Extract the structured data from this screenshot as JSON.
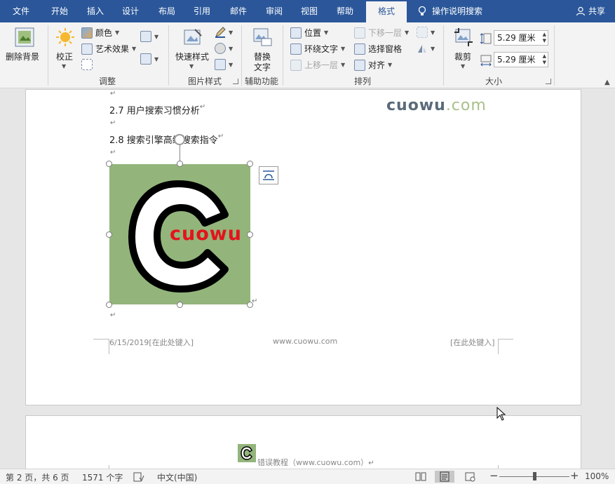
{
  "tabs": [
    {
      "label": "文件",
      "active": false
    },
    {
      "label": "开始",
      "active": false
    },
    {
      "label": "插入",
      "active": false
    },
    {
      "label": "设计",
      "active": false
    },
    {
      "label": "布局",
      "active": false
    },
    {
      "label": "引用",
      "active": false
    },
    {
      "label": "邮件",
      "active": false
    },
    {
      "label": "审阅",
      "active": false
    },
    {
      "label": "视图",
      "active": false
    },
    {
      "label": "帮助",
      "active": false
    },
    {
      "label": "格式",
      "active": true
    }
  ],
  "tell_me": {
    "label": "操作说明搜索",
    "icon": "lightbulb-icon"
  },
  "share": {
    "label": "共享",
    "icon": "person-icon"
  },
  "ribbon": {
    "adjust": {
      "remove_bg": "删除背景",
      "corrections": "校正",
      "color": "颜色",
      "artistic": "艺术效果",
      "group_label": "调整"
    },
    "picture_styles": {
      "quick_styles": "快速样式",
      "group_label": "图片样式"
    },
    "accessibility": {
      "alt_text_line1": "替换",
      "alt_text_line2": "文字",
      "group_label": "辅助功能"
    },
    "arrange": {
      "position": "位置",
      "wrap_text": "环绕文字",
      "bring_forward": "上移一层",
      "send_backward": "下移一层",
      "selection_pane": "选择窗格",
      "align": "对齐",
      "group_label": "排列"
    },
    "size": {
      "crop": "裁剪",
      "height": "5.29 厘米",
      "width": "5.29 厘米",
      "group_label": "大小"
    }
  },
  "document": {
    "heading_27": "2.7 用户搜索习惯分析",
    "heading_28": "2.8 搜索引擎高级搜索指令",
    "watermark_main": "cuowu",
    "watermark_suffix": ".com",
    "picture_text": "cuowu",
    "footer_date": "6/15/2019[在此处键入]",
    "footer_url": "www.cuowu.com",
    "footer_right": "[在此处键入]",
    "page2_header": "错误教程（www.cuowu.com）",
    "paragraph_mark": "↵"
  },
  "statusbar": {
    "page": "第 2 页，共 6 页",
    "words": "1571 个字",
    "language": "中文(中国)",
    "zoom_minus": "−",
    "zoom_plus": "+",
    "zoom_level": "100%",
    "zoom_value": 100
  },
  "colors": {
    "ribbon_blue": "#2b579a",
    "picture_green": "#93b57b",
    "logo_red": "#e3141b"
  }
}
